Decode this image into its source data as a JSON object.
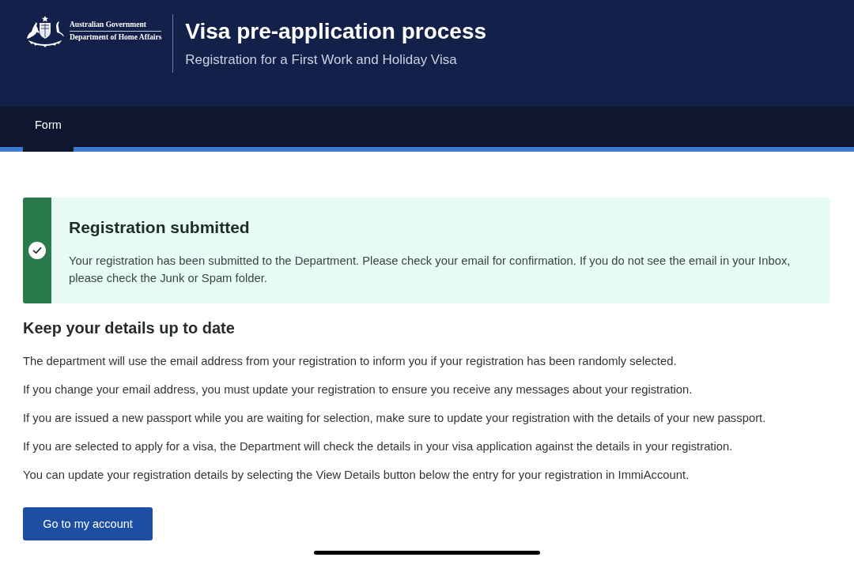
{
  "header": {
    "logo": {
      "line_1": "Australian Government",
      "line_2": "Department of Home Affairs"
    },
    "title": "Visa pre-application process",
    "subtitle": "Registration for a First Work and Holiday Visa"
  },
  "nav": {
    "tabs": [
      {
        "label": "Form",
        "selected": true
      }
    ]
  },
  "alert": {
    "kind": "success",
    "title": "Registration submitted",
    "message": "Your registration has been submitted to the Department. Please check your email for confirmation. If you do not see the email in your Inbox, please check the Junk or Spam folder."
  },
  "section": {
    "heading": "Keep your details up to date",
    "paragraphs": [
      "The department will use the email address from your registration to inform you if your registration has been randomly selected.",
      "If you change your email address, you must update your registration to ensure you receive any messages about your registration.",
      "If you are issued a new passport while you are waiting for selection, make sure to update your registration with the details of your new passport.",
      "If you are selected to apply for a visa, the Department will check the details in your visa application against the details in your registration.",
      "You can update your registration details by selecting the View Details button below the entry for your registration in ImmiAccount."
    ]
  },
  "button": {
    "label": "Go to my account"
  }
}
